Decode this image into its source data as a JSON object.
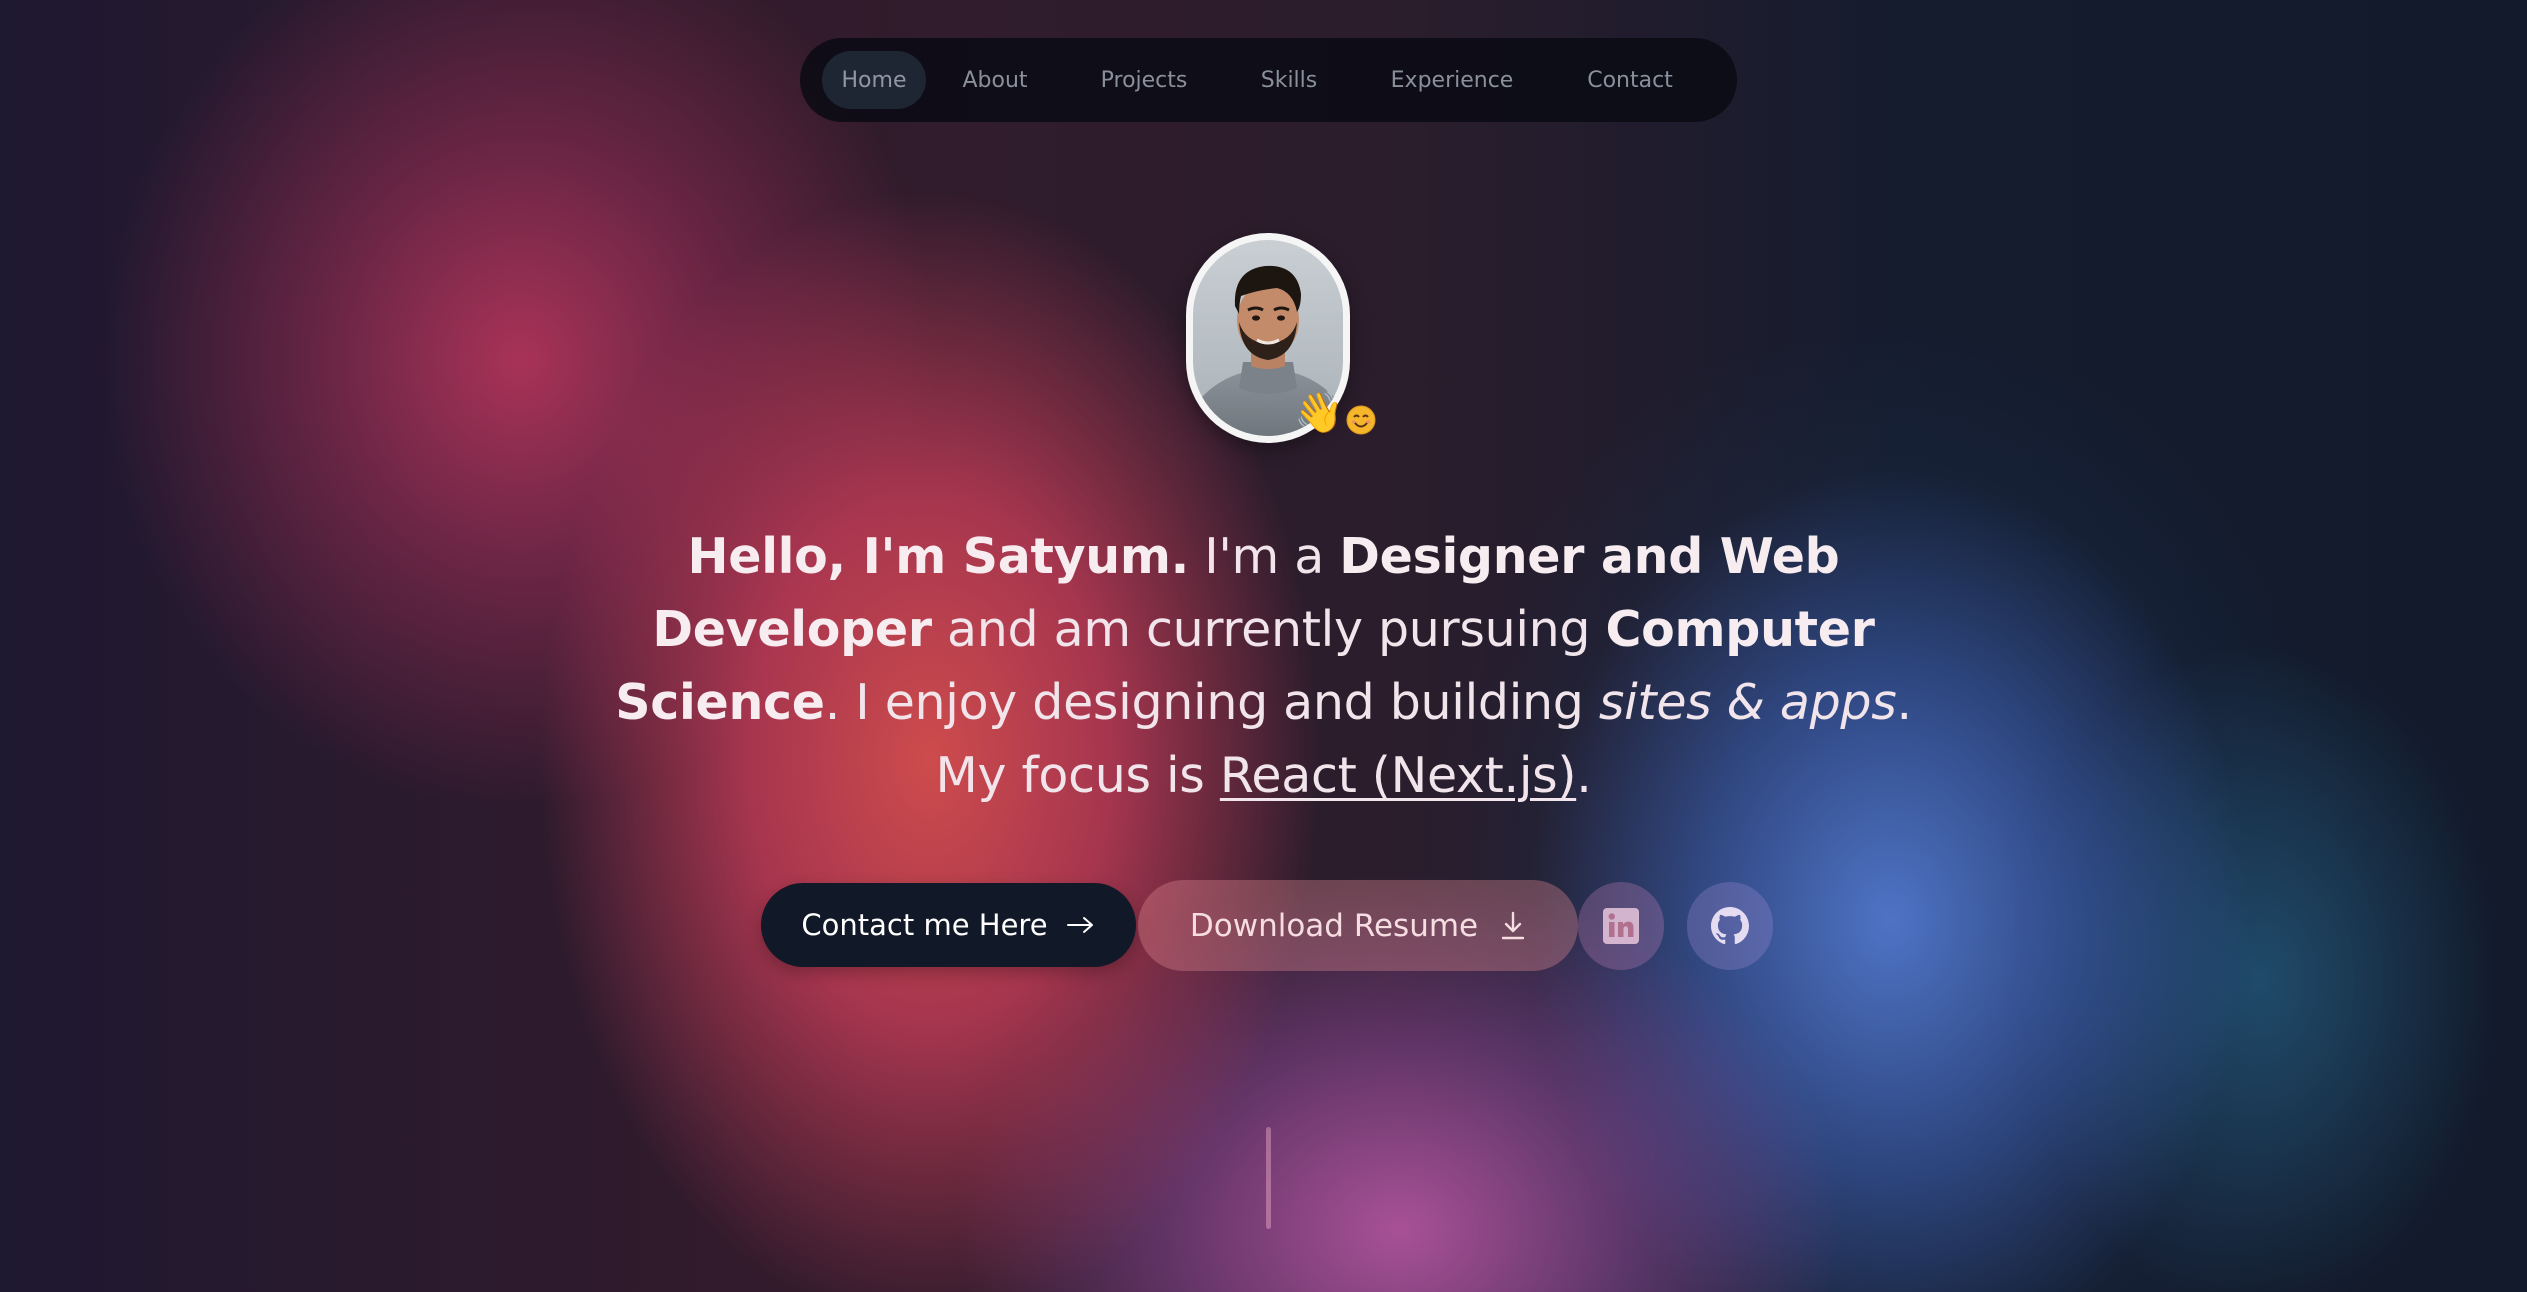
{
  "nav": {
    "items": [
      {
        "label": "Home",
        "active": true
      },
      {
        "label": "About"
      },
      {
        "label": "Projects"
      },
      {
        "label": "Skills"
      },
      {
        "label": "Experience"
      },
      {
        "label": "Contact"
      }
    ]
  },
  "hero": {
    "avatar_emoji": "👋",
    "smile_icon": "smiling-face-icon",
    "headline": {
      "p1_bold": "Hello, I'm Satyum.",
      "p2": " I'm a ",
      "p3_bold": "Designer and Web Developer",
      "p4": " and am currently pursuing ",
      "p5_bold": "Computer Science",
      "p6": ". I enjoy designing and building ",
      "p7_italic": "sites & apps",
      "p8": ". My focus is ",
      "p9_underline": "React (Next.js)",
      "p10": "."
    }
  },
  "actions": {
    "contact_label": "Contact me Here",
    "contact_icon": "arrow-right-icon",
    "resume_label": "Download Resume",
    "resume_icon": "download-icon",
    "linkedin_icon": "linkedin-icon",
    "github_icon": "github-icon"
  },
  "colors": {
    "nav_bg": "#0a0c14",
    "contact_bg": "#111827",
    "text": "#f1e4ea"
  }
}
